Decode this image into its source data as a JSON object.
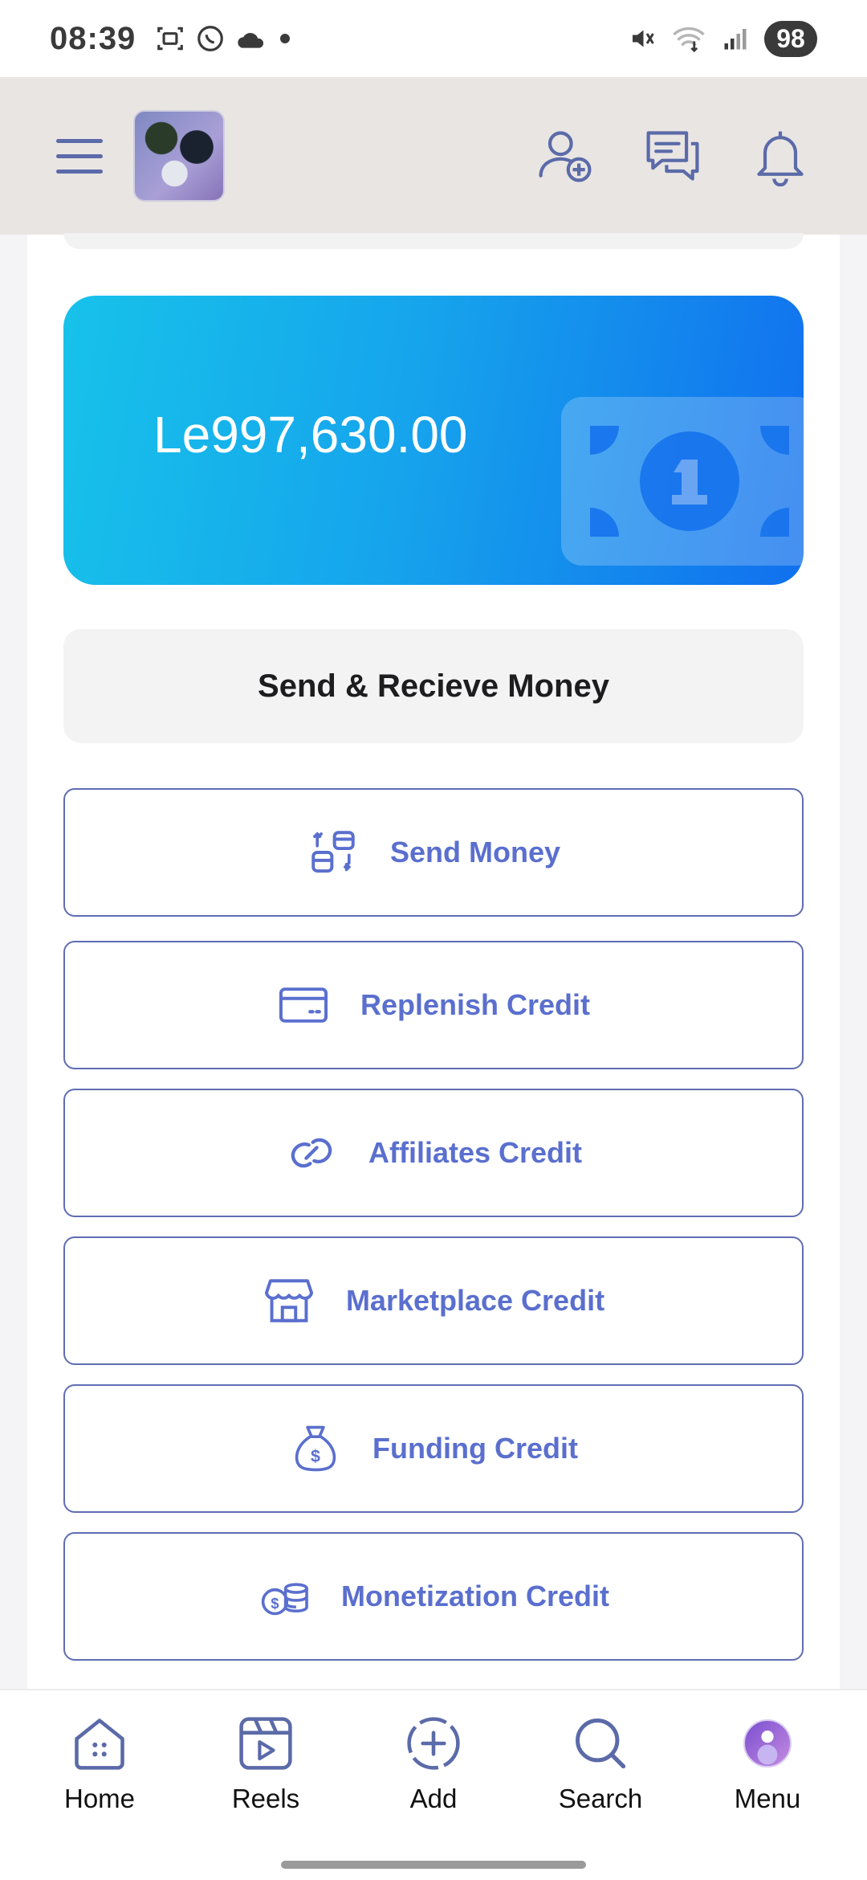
{
  "status_bar": {
    "time": "08:39",
    "battery": "98",
    "left_icons": [
      "screenshot-icon",
      "whatsapp-icon",
      "cloud-icon",
      "dot-icon"
    ],
    "right_icons": [
      "mute-icon",
      "wifi-icon",
      "signal-icon"
    ]
  },
  "header": {
    "menu_icon": "hamburger-icon",
    "logo": "app-logo",
    "actions": [
      "add-user-icon",
      "messages-icon",
      "notifications-icon"
    ]
  },
  "wallet": {
    "balance": "Le997,630.00",
    "illustration": "banknote-icon"
  },
  "section": {
    "title": "Send & Recieve Money"
  },
  "actions": [
    {
      "label": "Send Money",
      "icon": "transfer-icon"
    },
    {
      "label": "Replenish Credit",
      "icon": "credit-card-icon"
    },
    {
      "label": "Affiliates Credit",
      "icon": "link-icon"
    },
    {
      "label": "Marketplace Credit",
      "icon": "store-icon"
    },
    {
      "label": "Funding Credit",
      "icon": "money-bag-icon"
    },
    {
      "label": "Monetization Credit",
      "icon": "coins-icon"
    }
  ],
  "nav": [
    {
      "label": "Home",
      "icon": "home-icon"
    },
    {
      "label": "Reels",
      "icon": "reels-icon"
    },
    {
      "label": "Add",
      "icon": "add-icon"
    },
    {
      "label": "Search",
      "icon": "search-icon"
    },
    {
      "label": "Menu",
      "icon": "profile-avatar"
    }
  ],
  "colors": {
    "accent": "#5a6fce",
    "border": "#5f6db3",
    "card_gradient_start": "#17c2ea",
    "card_gradient_end": "#1170ee",
    "header_bg": "#e8e5e3"
  }
}
